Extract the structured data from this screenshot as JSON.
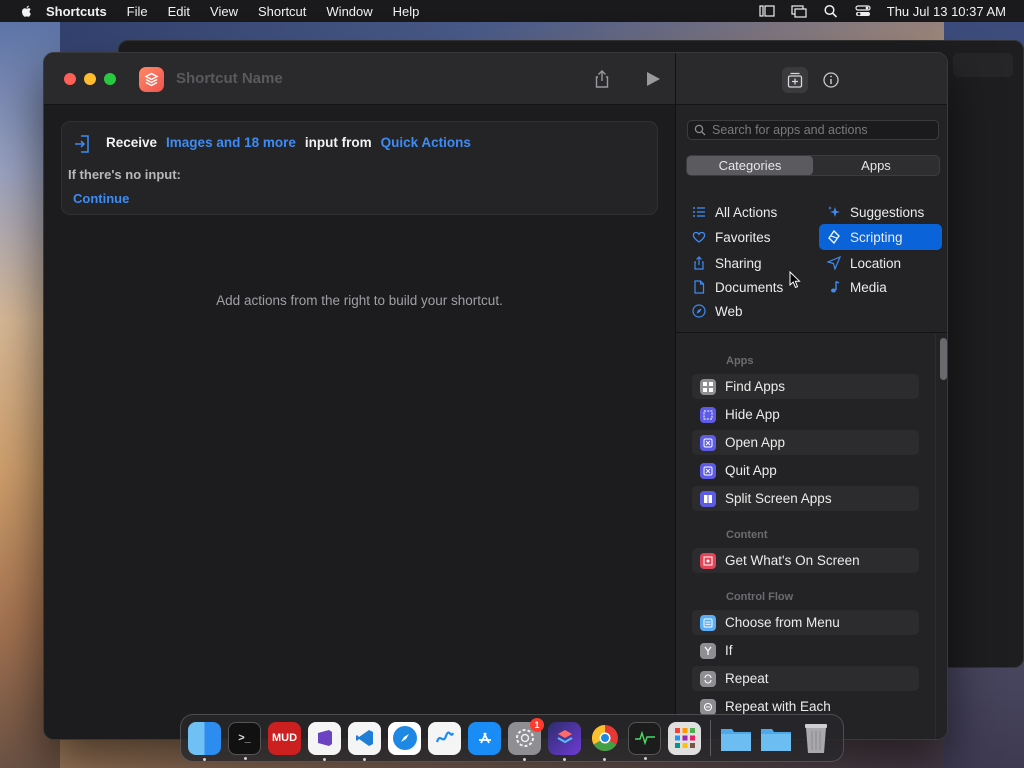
{
  "menubar": {
    "app_name": "Shortcuts",
    "items": [
      "File",
      "Edit",
      "View",
      "Shortcut",
      "Window",
      "Help"
    ],
    "clock": "Thu Jul 13  10:37 AM"
  },
  "window": {
    "title": "Shortcut Name",
    "receive": {
      "label": "Receive",
      "types": "Images and 18 more",
      "input_from": "input from",
      "source": "Quick Actions",
      "no_input_label": "If there's no input:",
      "no_input_action": "Continue"
    },
    "hint": "Add actions from the right to build your shortcut."
  },
  "sidebar": {
    "search_placeholder": "Search for apps and actions",
    "segments": [
      "Categories",
      "Apps"
    ],
    "categories_left": [
      {
        "label": "All Actions",
        "icon": "list-icon"
      },
      {
        "label": "Favorites",
        "icon": "heart-icon"
      },
      {
        "label": "Sharing",
        "icon": "share-icon"
      },
      {
        "label": "Documents",
        "icon": "document-icon"
      },
      {
        "label": "Web",
        "icon": "compass-icon"
      }
    ],
    "categories_right": [
      {
        "label": "Suggestions",
        "icon": "sparkle-icon"
      },
      {
        "label": "Scripting",
        "icon": "scripting-icon",
        "selected": true
      },
      {
        "label": "Location",
        "icon": "location-arrow-icon"
      },
      {
        "label": "Media",
        "icon": "music-note-icon"
      }
    ],
    "sections": [
      {
        "title": "Apps",
        "actions": [
          {
            "label": "Find Apps",
            "color": "#8e8e93"
          },
          {
            "label": "Hide App",
            "color": "#5e5ce6"
          },
          {
            "label": "Open App",
            "color": "#5e5ce6"
          },
          {
            "label": "Quit App",
            "color": "#5e5ce6"
          },
          {
            "label": "Split Screen Apps",
            "color": "#5e5ce6"
          }
        ]
      },
      {
        "title": "Content",
        "actions": [
          {
            "label": "Get What's On Screen",
            "color": "#e0455a"
          }
        ]
      },
      {
        "title": "Control Flow",
        "actions": [
          {
            "label": "Choose from Menu",
            "color": "#5aaef7"
          },
          {
            "label": "If",
            "color": "#8e8e93"
          },
          {
            "label": "Repeat",
            "color": "#8e8e93"
          },
          {
            "label": "Repeat with Each",
            "color": "#8e8e93"
          }
        ]
      }
    ]
  },
  "dock": {
    "apps": [
      {
        "name": "Finder",
        "color": "#2d8cf0"
      },
      {
        "name": "Terminal",
        "color": "#111111"
      },
      {
        "name": "MUD",
        "color": "#cc2020",
        "label": "MUD"
      },
      {
        "name": "Visual Studio",
        "color": "#6b42c1"
      },
      {
        "name": "VS Code",
        "color": "#1f7fd6"
      },
      {
        "name": "Safari",
        "color": "#1e88e5"
      },
      {
        "name": "Freeform",
        "color": "#f5f5f5"
      },
      {
        "name": "App Store",
        "color": "#1a8cf5"
      },
      {
        "name": "System Settings",
        "color": "#777777",
        "badge": "1"
      },
      {
        "name": "Shortcuts",
        "color": "#3b3bd6"
      },
      {
        "name": "Chrome",
        "color": "#f5f5f5"
      },
      {
        "name": "Activity Monitor",
        "color": "#1c1c1c"
      },
      {
        "name": "Launchpad",
        "color": "#d9d9d9"
      }
    ],
    "others": [
      {
        "name": "Folder",
        "color": "#4fa9e8"
      },
      {
        "name": "Downloads",
        "color": "#4fa9e8"
      },
      {
        "name": "Trash",
        "color": "#a8a8ad"
      }
    ]
  }
}
